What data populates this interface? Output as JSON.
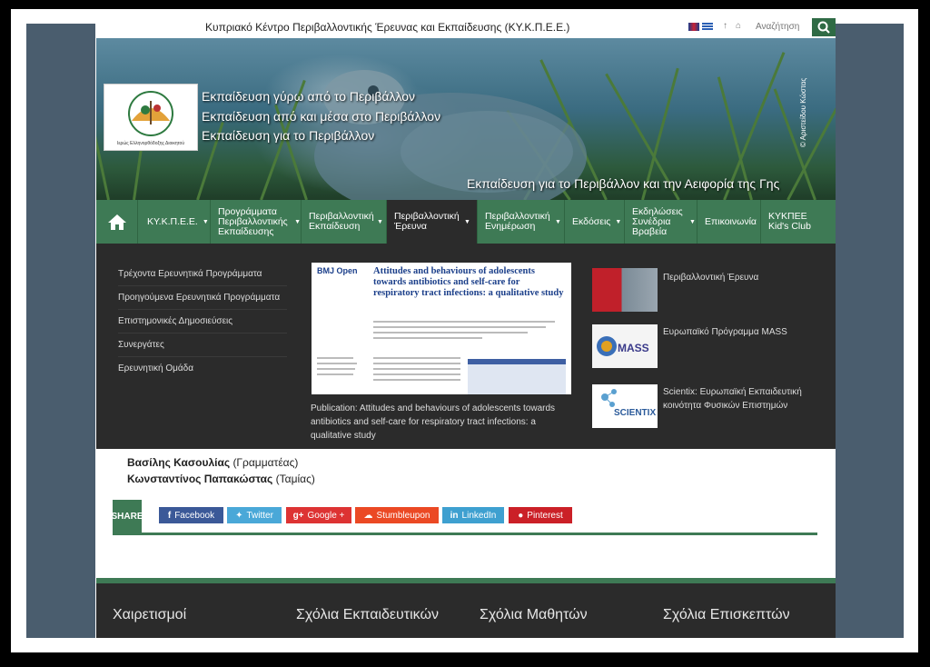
{
  "site": {
    "title": "Κυπριακό Κέντρο Περιβαλλοντικής Έρευνας και Εκπαίδευσης (ΚΥ.Κ.Π.Ε.Ε.)",
    "search_placeholder": "Αναζήτηση",
    "icons": [
      "uk-flag-icon",
      "greek-flag-icon",
      "arrow-up-icon",
      "home-small-icon",
      "search-icon"
    ]
  },
  "hero": {
    "taglines": [
      "Εκπαίδευση γύρω από το Περιβάλλον",
      "Εκπαίδευση από και μέσα στο Περιβάλλον",
      "Εκπαίδευση για το Περιβάλλον"
    ],
    "slogan": "Εκπαίδευση για το Περιβάλλον και την Αειφορία της Γης",
    "credit": "© Αριστείδου Κώστας",
    "logo_text": "Ιερώς Ελληνορθόδοξης Διοικητού"
  },
  "nav": {
    "items": [
      {
        "label": "ΚΥ.Κ.Π.Ε.Ε."
      },
      {
        "label": "Προγράμματα Περιβαλλοντικής Εκπαίδευσης"
      },
      {
        "label": "Περιβαλλοντική Εκπαίδευση"
      },
      {
        "label": "Περιβαλλοντική Έρευνα"
      },
      {
        "label": "Περιβαλλοντική Ενημέρωση"
      },
      {
        "label": "Εκδόσεις"
      },
      {
        "label": "Εκδηλώσεις Συνέδρια Βραβεία"
      },
      {
        "label": "Επικοινωνία"
      },
      {
        "label": "ΚΥΚΠΕΕ Kid's Club"
      }
    ]
  },
  "mega": {
    "links": [
      "Τρέχοντα Ερευνητικά Προγράμματα",
      "Προηγούμενα Ερευνητικά Προγράμματα",
      "Επιστημονικές Δημοσιεύσεις",
      "Συνεργάτες",
      "Ερευνητική Ομάδα"
    ],
    "paper": {
      "journal": "BMJ Open",
      "title": "Attitudes and behaviours of adolescents towards antibiotics and self-care for respiratory tract infections: a qualitative study"
    },
    "publication_caption": "Publication: Attitudes and behaviours of adolescents towards antibiotics and self-care for respiratory tract infections: a qualitative study",
    "thumbs": [
      {
        "label": "Περιβαλλοντική Έρευνα"
      },
      {
        "label": "Ευρωπαϊκό Πρόγραμμα MASS",
        "badge": "MASS"
      },
      {
        "label": "Scientix: Ευρωπαϊκή Εκπαιδευτική κοινότητα Φυσικών Επιστημών",
        "badge": "SCIENTIX"
      }
    ]
  },
  "content": {
    "person1_name": "Βασίλης Κασουλίας",
    "person1_role": "(Γραμματέας)",
    "person2_name": "Κωνσταντίνος Παπακώστας",
    "person2_role": "(Ταμίας)"
  },
  "share": {
    "label": "SHARE",
    "buttons": [
      {
        "label": "Facebook",
        "icon": "f"
      },
      {
        "label": "Twitter",
        "icon": "t"
      },
      {
        "label": "Google +",
        "icon": "g+"
      },
      {
        "label": "Stumbleupon",
        "icon": "su"
      },
      {
        "label": "LinkedIn",
        "icon": "in"
      },
      {
        "label": "Pinterest",
        "icon": "p"
      }
    ],
    "colors": [
      "#3b5998",
      "#4aa8d8",
      "#dd3333",
      "#eb4924",
      "#3ea0d0",
      "#cb2027"
    ]
  },
  "footer": {
    "headings": [
      "Χαιρετισμοί",
      "Σχόλια Εκπαιδευτικών",
      "Σχόλια Μαθητών",
      "Σχόλια Επισκεπτών"
    ]
  },
  "colors": {
    "brand_green": "#3e7a55",
    "dark_panel": "#2b2b2b",
    "side_panel": "#4a5d6e"
  }
}
